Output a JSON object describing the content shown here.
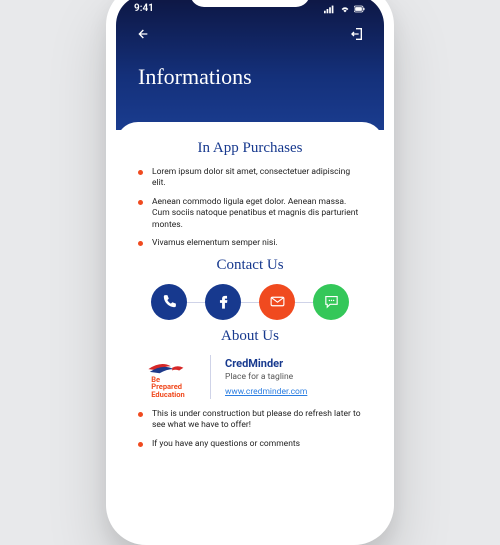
{
  "status": {
    "time": "9:41"
  },
  "header": {
    "title": "Informations"
  },
  "sections": {
    "purchases": {
      "heading": "In App Purchases",
      "items": [
        "Lorem ipsum dolor sit amet, consectetuer adipiscing elit.",
        "Aenean commodo ligula eget dolor. Aenean massa. Cum sociis natoque penatibus et magnis dis parturient montes.",
        "Vivamus elementum semper nisi."
      ]
    },
    "contact": {
      "heading": "Contact Us",
      "buttons": [
        {
          "name": "phone",
          "color": "#17398e"
        },
        {
          "name": "facebook",
          "color": "#17398e"
        },
        {
          "name": "email",
          "color": "#f04a1f"
        },
        {
          "name": "sms",
          "color": "#34c759"
        }
      ]
    },
    "about": {
      "heading": "About Us",
      "logo_lines": [
        "Be",
        "Prepared",
        "Education"
      ],
      "brand_name": "CredMinder",
      "tagline": "Place for a tagline",
      "url": "www.credminder.com",
      "items": [
        "This is under construction but please do refresh later to see what we have to offer!",
        "If you have any questions or comments"
      ]
    }
  }
}
